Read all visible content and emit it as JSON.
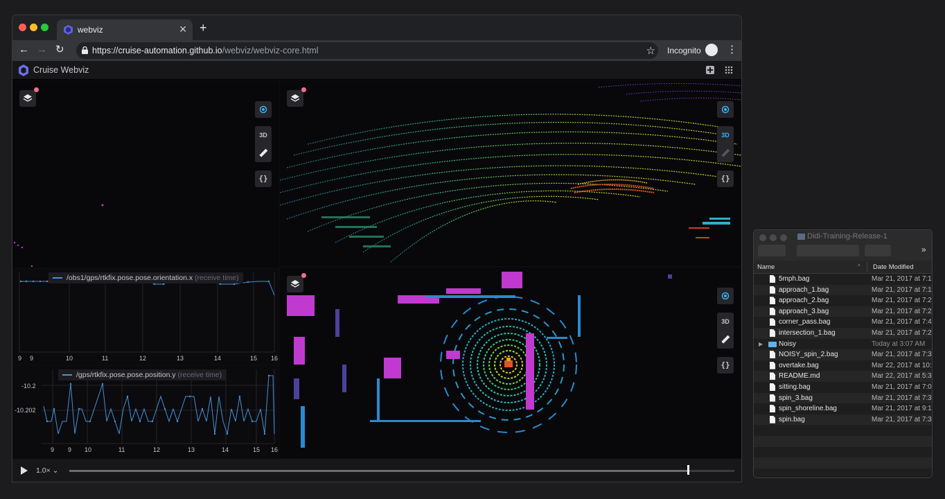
{
  "browser": {
    "tab_title": "webviz",
    "url_host": "https://cruise-automation.github.io",
    "url_path": "/webviz/webviz-core.html",
    "profile": "Incognito"
  },
  "app": {
    "title": "Cruise Webviz",
    "btn_3d": "3D",
    "btn_braces": "{}",
    "speed": "1.0×",
    "playback_progress": 0.93
  },
  "plot_top": {
    "topic": "/obs1/gps/rtkfix.pose.pose.orientation.x",
    "suffix": "(receive time)",
    "x_ticks": [
      "9",
      "9",
      "10",
      "11",
      "12",
      "13",
      "14",
      "15",
      "16"
    ]
  },
  "plot_bottom": {
    "topic": "/gps/rtkfix.pose.pose.position.y",
    "suffix": "(receive time)",
    "y_ticks": [
      "-10.2",
      "-10.202"
    ],
    "x_ticks": [
      "9",
      "9",
      "10",
      "11",
      "12",
      "13",
      "14",
      "15",
      "16"
    ]
  },
  "finder": {
    "title": "Didi-Training-Release-1",
    "col_name": "Name",
    "col_date": "Date Modified",
    "more": "»",
    "files": [
      {
        "name": "5mph.bag",
        "date": "Mar 21, 2017 at 7:1",
        "kind": "file"
      },
      {
        "name": "approach_1.bag",
        "date": "Mar 21, 2017 at 7:1",
        "kind": "file"
      },
      {
        "name": "approach_2.bag",
        "date": "Mar 21, 2017 at 7:2",
        "kind": "file"
      },
      {
        "name": "approach_3.bag",
        "date": "Mar 21, 2017 at 7:2",
        "kind": "file"
      },
      {
        "name": "corner_pass.bag",
        "date": "Mar 21, 2017 at 7:4",
        "kind": "file"
      },
      {
        "name": "intersection_1.bag",
        "date": "Mar 21, 2017 at 7:2",
        "kind": "file"
      },
      {
        "name": "Noisy",
        "date": "Today at 3:07 AM",
        "kind": "folder"
      },
      {
        "name": "NOISY_spin_2.bag",
        "date": "Mar 21, 2017 at 7:3",
        "kind": "file"
      },
      {
        "name": "overtake.bag",
        "date": "Mar 22, 2017 at 10:",
        "kind": "file"
      },
      {
        "name": "README.md",
        "date": "Mar 22, 2017 at 5:3",
        "kind": "doc"
      },
      {
        "name": "sitting.bag",
        "date": "Mar 21, 2017 at 7:0",
        "kind": "file"
      },
      {
        "name": "spin_3.bag",
        "date": "Mar 21, 2017 at 7:3",
        "kind": "file"
      },
      {
        "name": "spin_shoreline.bag",
        "date": "Mar 21, 2017 at 9:1",
        "kind": "file"
      },
      {
        "name": "spin.bag",
        "date": "Mar 21, 2017 at 7:3",
        "kind": "file"
      }
    ]
  }
}
